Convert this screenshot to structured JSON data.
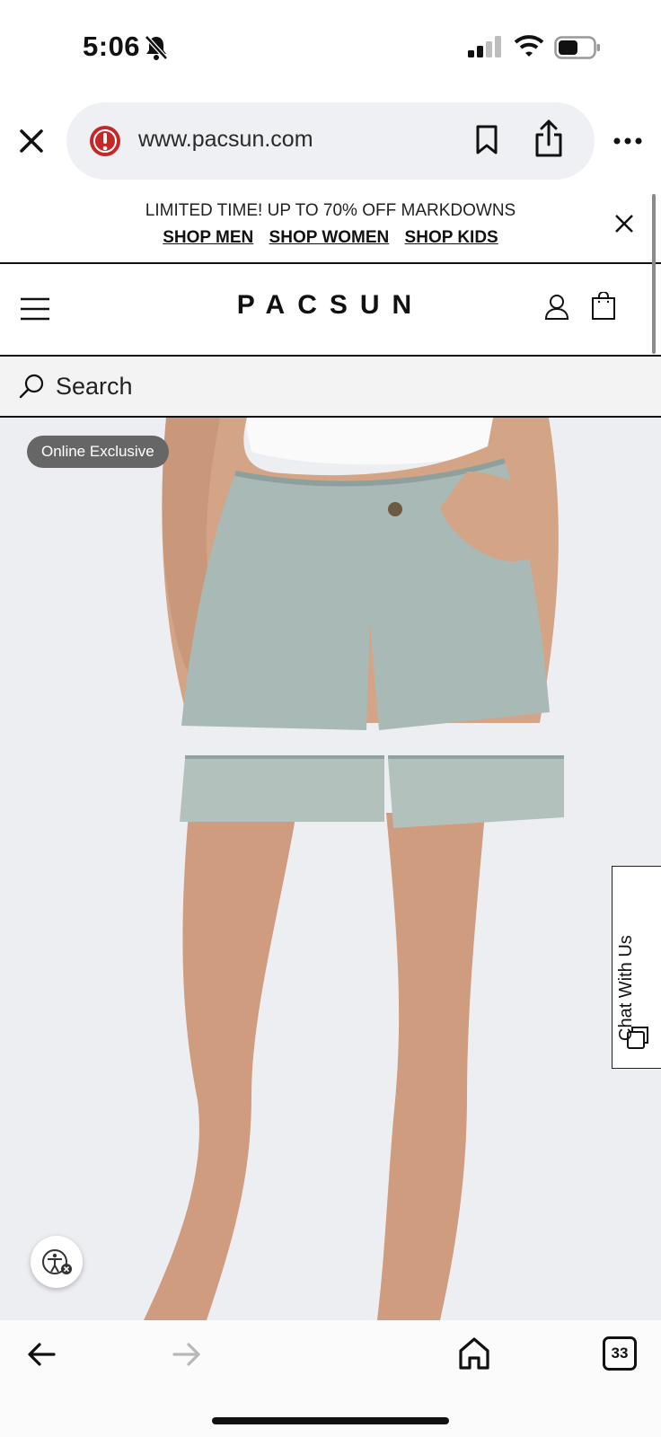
{
  "status_bar": {
    "time": "5:06",
    "icons": [
      "bell-off-icon",
      "signal-icon",
      "wifi-icon",
      "battery-icon"
    ]
  },
  "browser": {
    "url": "www.pacsun.com",
    "tab_count": "33"
  },
  "promo": {
    "text": "LIMITED TIME! UP TO 70% OFF MARKDOWNS",
    "links": [
      "SHOP MEN",
      "SHOP WOMEN",
      "SHOP KIDS"
    ]
  },
  "header": {
    "logo": "PACSUN"
  },
  "search": {
    "label": "Search"
  },
  "product": {
    "badge": "Online Exclusive"
  },
  "chat": {
    "label": "Chat With Us"
  },
  "colors": {
    "accent": "#111111",
    "badge_bg": "#666666",
    "warning": "#c62828",
    "image_bg": "#eceef1"
  }
}
